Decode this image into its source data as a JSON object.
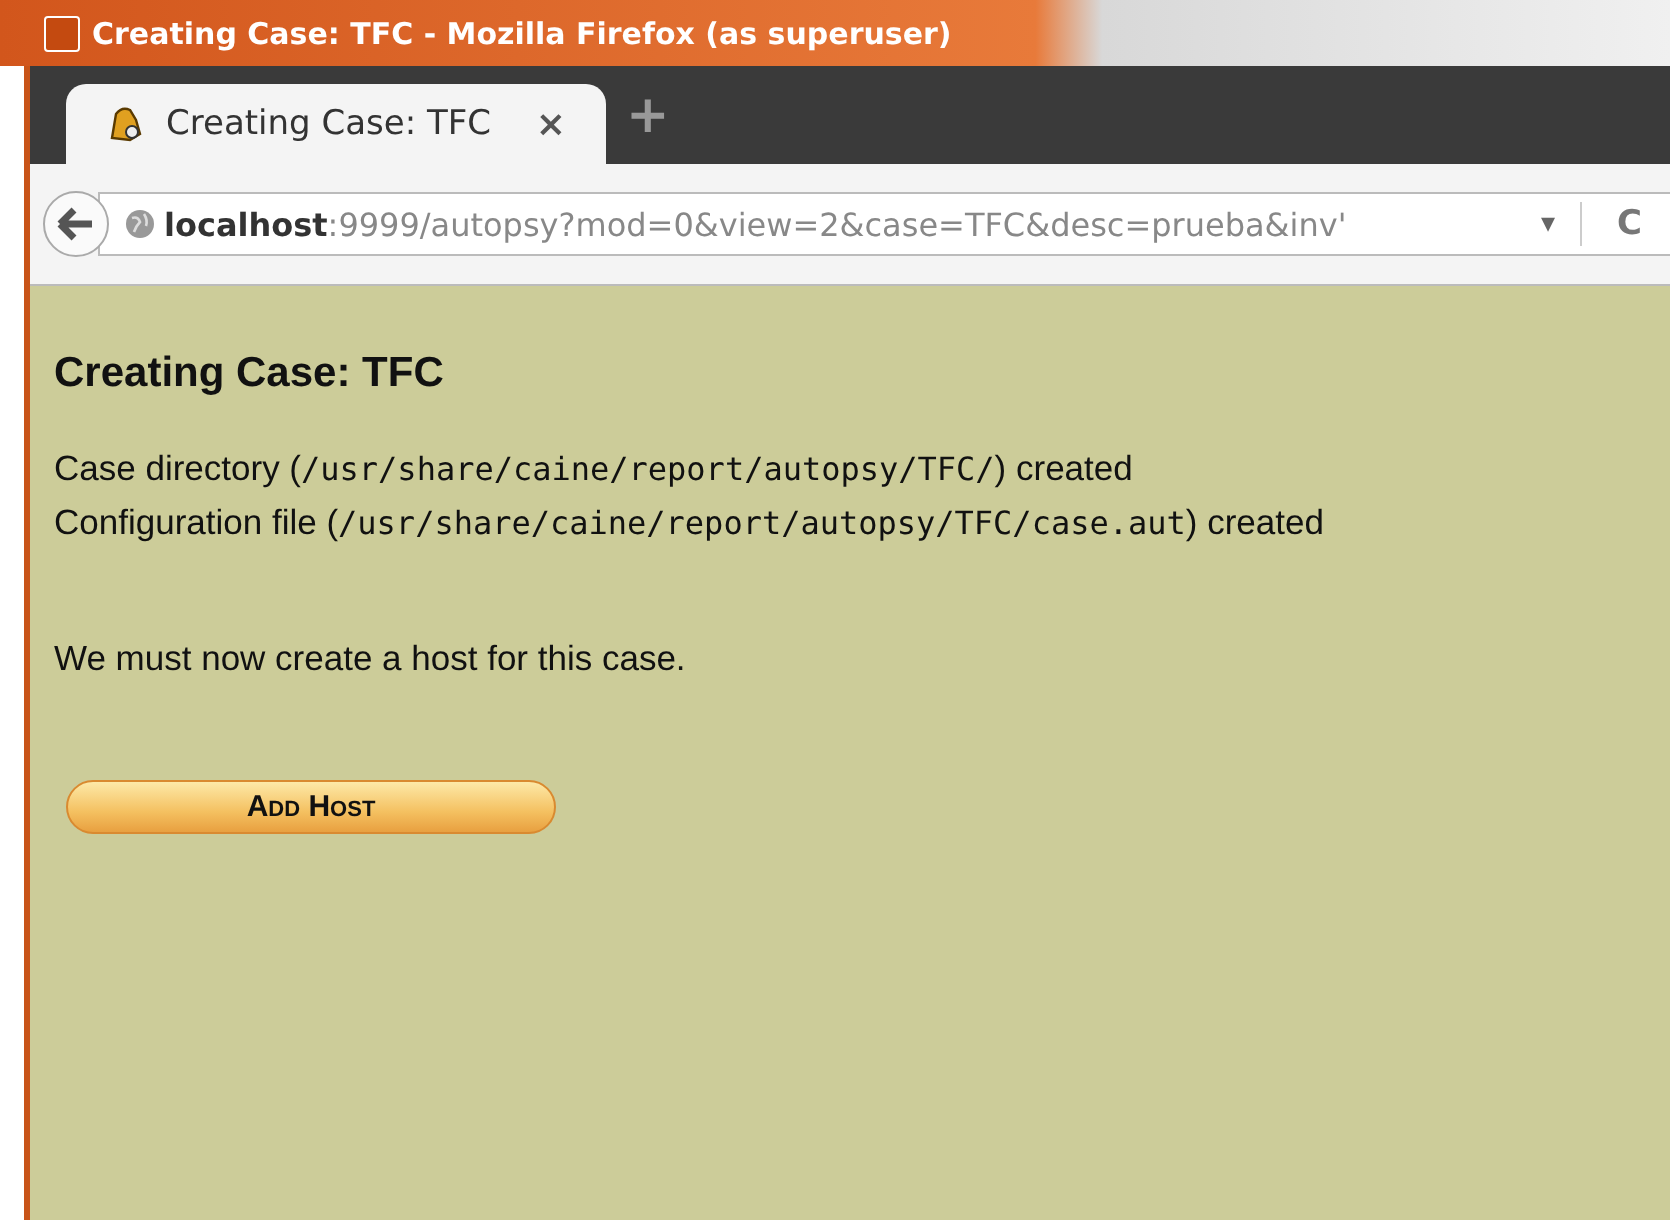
{
  "window": {
    "title": "Creating Case: TFC - Mozilla Firefox (as superuser)"
  },
  "tabs": [
    {
      "label": "Creating Case: TFC",
      "close": "×",
      "selected": true
    }
  ],
  "new_tab": "+",
  "address_bar": {
    "host": "localhost",
    "rest": ":9999/autopsy?mod=0&view=2&case=TFC&desc=prueba&inv'",
    "dropdown": "▾",
    "reload": "C"
  },
  "page": {
    "heading": "Creating Case: TFC",
    "lines": [
      [
        {
          "kind": "plain",
          "text": "Case directory ("
        },
        {
          "kind": "mono",
          "text": "/usr/share/caine/report/autopsy/TFC/"
        },
        {
          "kind": "plain",
          "text": ") created"
        }
      ],
      [
        {
          "kind": "plain",
          "text": "Configuration file ("
        },
        {
          "kind": "mono",
          "text": "/usr/share/caine/report/autopsy/TFC/case.aut"
        },
        {
          "kind": "plain",
          "text": ") created"
        }
      ]
    ],
    "message": "We must now create a host for this case.",
    "button": "Add Host"
  }
}
